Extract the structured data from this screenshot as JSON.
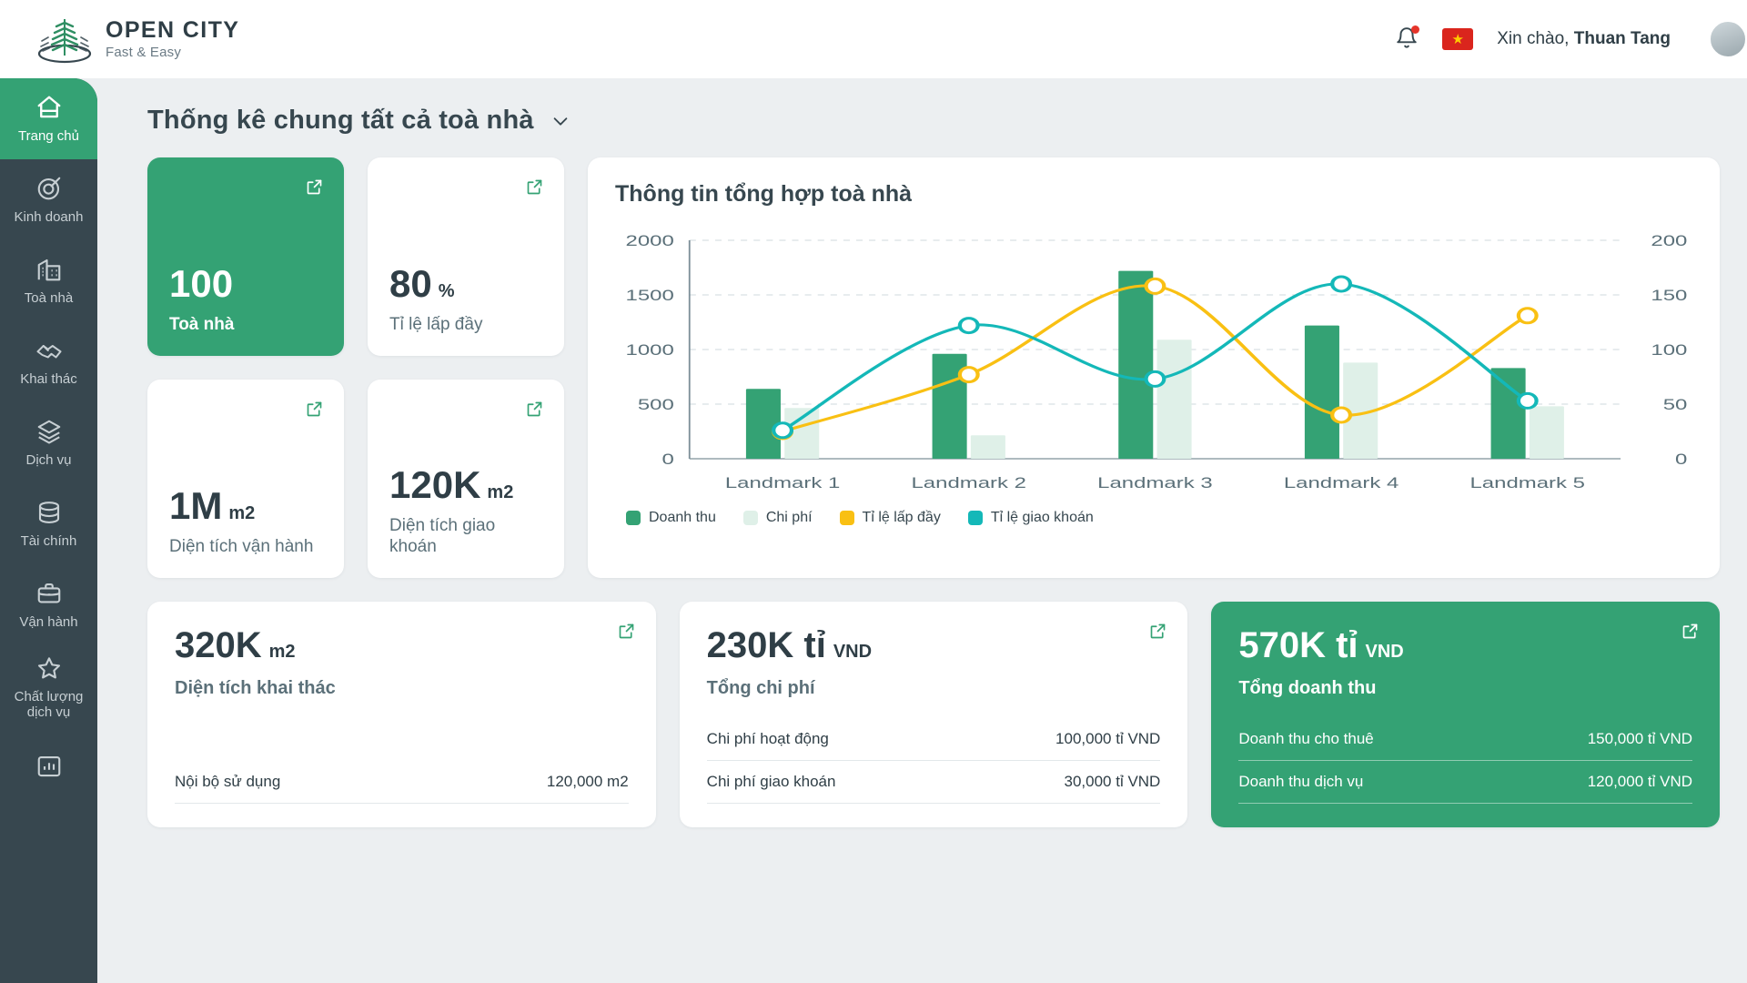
{
  "brand": {
    "title": "OPEN CITY",
    "tagline": "Fast & Easy",
    "accent": "#34a274",
    "dark": "#37474f"
  },
  "topbar": {
    "greeting": "Xin chào,",
    "user_name": "Thuan Tang",
    "bell_icon": "bell-icon",
    "flag_icon": "vietnam-flag-icon",
    "avatar_icon": "user-avatar"
  },
  "sidebar": {
    "items": [
      {
        "label": "Trang chủ",
        "icon": "home-icon",
        "active": true
      },
      {
        "label": "Kinh doanh",
        "icon": "target-icon",
        "active": false
      },
      {
        "label": "Toà nhà",
        "icon": "building-icon",
        "active": false
      },
      {
        "label": "Khai thác",
        "icon": "handshake-icon",
        "active": false
      },
      {
        "label": "Dịch vụ",
        "icon": "layers-icon",
        "active": false
      },
      {
        "label": "Tài chính",
        "icon": "database-icon",
        "active": false
      },
      {
        "label": "Vận hành",
        "icon": "briefcase-icon",
        "active": false
      },
      {
        "label": "Chất lượng dịch vụ",
        "icon": "star-icon",
        "active": false
      },
      {
        "label": "",
        "icon": "chart-icon",
        "active": false
      }
    ]
  },
  "page": {
    "title": "Thống kê chung tất cả toà nhà",
    "dropdown_icon": "chevron-down-icon"
  },
  "kpis": [
    {
      "value": "100",
      "unit": "",
      "label": "Toà nhà",
      "highlight": true,
      "action_icon": "external-link-icon"
    },
    {
      "value": "80",
      "unit": "%",
      "label": "Tỉ lệ lấp đầy",
      "highlight": false,
      "action_icon": "external-link-icon"
    },
    {
      "value": "1M",
      "unit": "m2",
      "label": "Diện tích vận hành",
      "highlight": false,
      "action_icon": "external-link-icon"
    },
    {
      "value": "120K",
      "unit": "m2",
      "label": "Diện tích giao khoán",
      "highlight": false,
      "action_icon": "external-link-icon"
    }
  ],
  "chart_card": {
    "title": "Thông tin tổng hợp toà nhà"
  },
  "chart_data": {
    "type": "bar",
    "title": "Thông tin tổng hợp toà nhà",
    "xlabel": "",
    "ylabel": "",
    "grid": true,
    "legend_position": "bottom-left",
    "categories": [
      "Landmark 1",
      "Landmark 2",
      "Landmark 3",
      "Landmark 4",
      "Landmark 5"
    ],
    "y_left": {
      "ticks": [
        0,
        500,
        1000,
        1500,
        2000
      ],
      "min": 0,
      "max": 2000
    },
    "y_right": {
      "ticks": [
        0,
        50,
        100,
        150,
        200
      ],
      "min": 0,
      "max": 200
    },
    "series": [
      {
        "name": "Doanh thu",
        "type": "bar",
        "axis": "left",
        "color": "#34a274",
        "values": [
          640,
          960,
          1720,
          1220,
          830
        ]
      },
      {
        "name": "Chi phí",
        "type": "bar",
        "axis": "left",
        "color": "#dff0e8",
        "values": [
          465,
          215,
          1090,
          880,
          480
        ]
      },
      {
        "name": "Tỉ lệ lấp đầy",
        "type": "line",
        "axis": "right",
        "color": "#f9c013",
        "values": [
          25,
          77,
          158,
          40,
          131
        ]
      },
      {
        "name": "Tỉ lệ giao khoán",
        "type": "line",
        "axis": "right",
        "color": "#14b8b8",
        "values": [
          26,
          122,
          73,
          160,
          53
        ]
      }
    ]
  },
  "bottom_cards": [
    {
      "value": "320K",
      "unit": "m2",
      "label": "Diện tích khai thác",
      "highlight": false,
      "action_icon": "external-link-icon",
      "rows": [
        {
          "label": "Nội bộ sử dụng",
          "value": "120,000 m2"
        }
      ]
    },
    {
      "value": "230K tỉ",
      "unit": "VND",
      "label": "Tổng chi phí",
      "highlight": false,
      "action_icon": "external-link-icon",
      "rows": [
        {
          "label": "Chi phí hoạt động",
          "value": "100,000 tỉ VND"
        },
        {
          "label": "Chi phí giao khoán",
          "value": "30,000 tỉ VND"
        }
      ]
    },
    {
      "value": "570K tỉ",
      "unit": "VND",
      "label": "Tổng doanh thu",
      "highlight": true,
      "action_icon": "external-link-icon",
      "rows": [
        {
          "label": "Doanh thu cho thuê",
          "value": "150,000 tỉ VND"
        },
        {
          "label": "Doanh thu dịch vụ",
          "value": "120,000 tỉ VND"
        }
      ]
    }
  ]
}
